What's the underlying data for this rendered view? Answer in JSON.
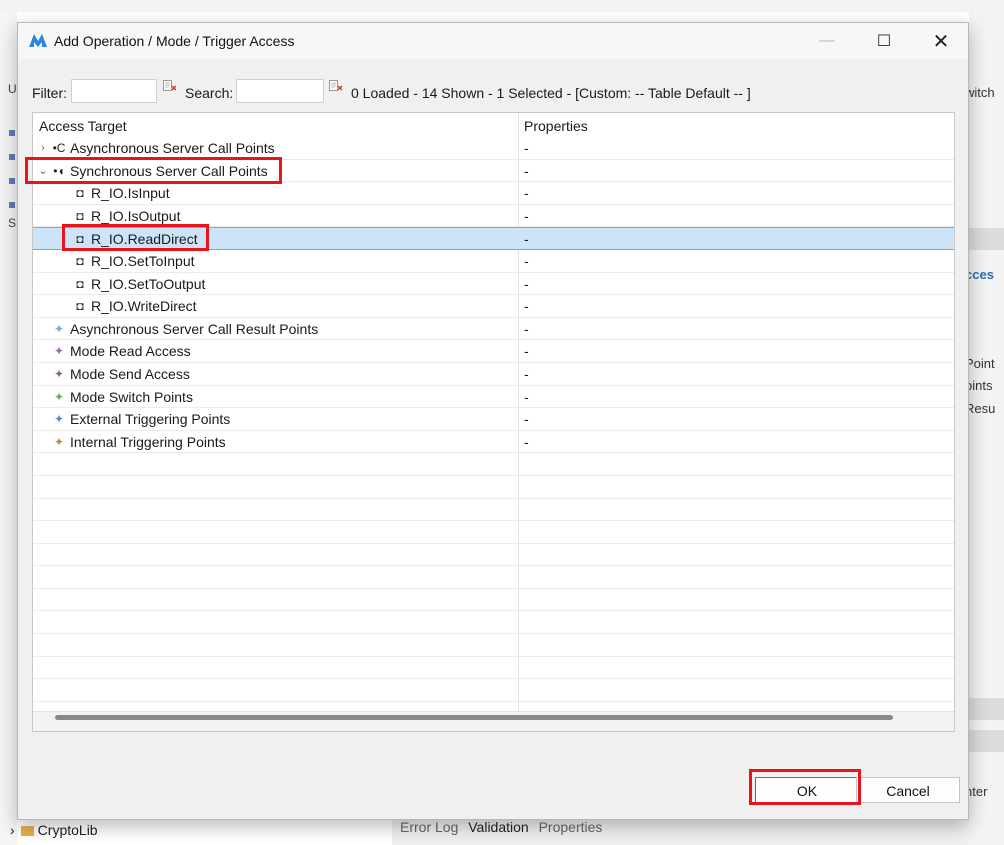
{
  "dialog": {
    "title": "Add Operation / Mode / Trigger Access",
    "window_controls": {
      "minimize": "—",
      "maximize": "☐",
      "close": "✕"
    }
  },
  "filter": {
    "filter_label": "Filter:",
    "filter_value": "",
    "search_label": "Search:",
    "search_value": "",
    "status": "0 Loaded - 14 Shown - 1 Selected -  [Custom: -- Table Default -- ]"
  },
  "table": {
    "columns": [
      "Access Target",
      "Properties"
    ],
    "rows": [
      {
        "label": "Asynchronous Server Call Points",
        "value": "-",
        "level": 0,
        "expander": "›",
        "icon": "async-server-call-icon",
        "glyph": "•C",
        "color": "#222"
      },
      {
        "label": "Synchronous Server Call Points",
        "value": "-",
        "level": 0,
        "expander": "⌄",
        "icon": "sync-server-call-icon",
        "glyph": "•◖",
        "color": "#222"
      },
      {
        "label": "R_IO.IsInput",
        "value": "-",
        "level": 1,
        "expander": "",
        "icon": "operation-icon",
        "glyph": "◘",
        "color": "#333"
      },
      {
        "label": "R_IO.IsOutput",
        "value": "-",
        "level": 1,
        "expander": "",
        "icon": "operation-icon",
        "glyph": "◘",
        "color": "#333"
      },
      {
        "label": "R_IO.ReadDirect",
        "value": "-",
        "level": 1,
        "expander": "",
        "icon": "operation-icon",
        "glyph": "◘",
        "color": "#333",
        "selected": true
      },
      {
        "label": "R_IO.SetToInput",
        "value": "-",
        "level": 1,
        "expander": "",
        "icon": "operation-icon",
        "glyph": "◘",
        "color": "#333"
      },
      {
        "label": "R_IO.SetToOutput",
        "value": "-",
        "level": 1,
        "expander": "",
        "icon": "operation-icon",
        "glyph": "◘",
        "color": "#333"
      },
      {
        "label": "R_IO.WriteDirect",
        "value": "-",
        "level": 1,
        "expander": "",
        "icon": "operation-icon",
        "glyph": "◘",
        "color": "#333"
      },
      {
        "label": "Asynchronous Server Call Result Points",
        "value": "-",
        "level": 0,
        "expander": "",
        "icon": "result-point-icon",
        "glyph": "✦",
        "color": "#6fa8d8"
      },
      {
        "label": "Mode Read Access",
        "value": "-",
        "level": 0,
        "expander": "",
        "icon": "mode-read-icon",
        "glyph": "✦",
        "color": "#9b6aa8"
      },
      {
        "label": "Mode Send Access",
        "value": "-",
        "level": 0,
        "expander": "",
        "icon": "mode-send-icon",
        "glyph": "✦",
        "color": "#8d5f8f"
      },
      {
        "label": "Mode Switch Points",
        "value": "-",
        "level": 0,
        "expander": "",
        "icon": "mode-switch-icon",
        "glyph": "✦",
        "color": "#6faa5a"
      },
      {
        "label": "External Triggering Points",
        "value": "-",
        "level": 0,
        "expander": "",
        "icon": "external-trigger-icon",
        "glyph": "✦",
        "color": "#4f8fcf"
      },
      {
        "label": "Internal Triggering Points",
        "value": "-",
        "level": 0,
        "expander": "",
        "icon": "internal-trigger-icon",
        "glyph": "✦",
        "color": "#c08a3e"
      }
    ]
  },
  "buttons": {
    "ok": "OK",
    "cancel": "Cancel"
  },
  "background": {
    "right_fragments": [
      "witch",
      "cces",
      "Point",
      "oints",
      "Resu",
      "nter"
    ],
    "left_fragments": [
      "U",
      "S"
    ],
    "bottom_left": "CryptoLib",
    "bottom_tabs": [
      "Error Log",
      "Validation",
      "Properties"
    ]
  },
  "colors": {
    "highlight": "#e8141a",
    "selection": "#cce4f7",
    "accent": "#2b7ad6"
  }
}
